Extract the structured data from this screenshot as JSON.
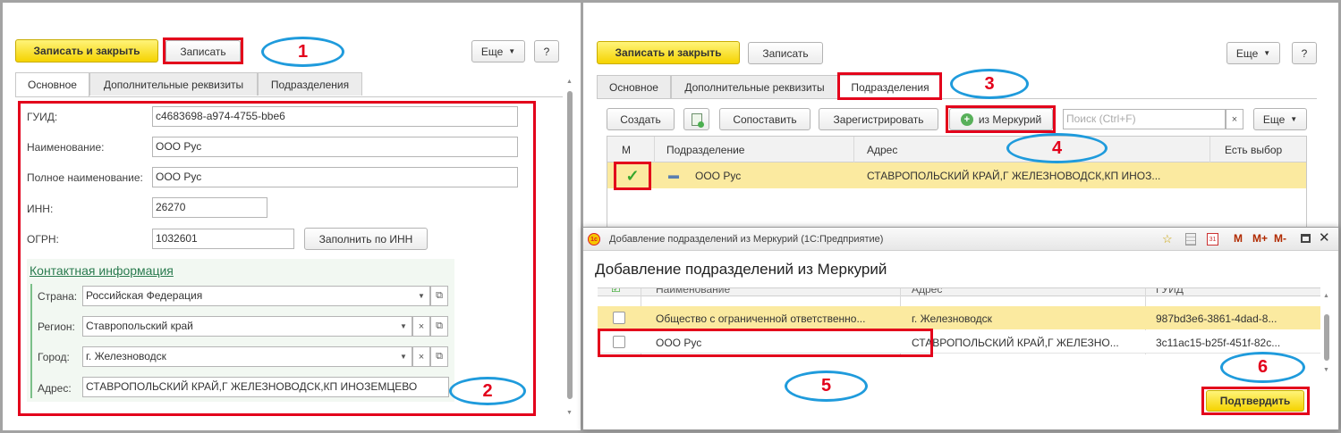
{
  "left": {
    "btn_save_close": "Записать и закрыть",
    "btn_save": "Записать",
    "btn_more": "Еще",
    "btn_help": "?",
    "tabs": [
      "Основное",
      "Дополнительные реквизиты",
      "Подразделения"
    ],
    "fields": {
      "guid_label": "ГУИД:",
      "guid_value": "c4683698-a974-4755-bbe6",
      "name_label": "Наименование:",
      "name_value": "ООО Рус",
      "fullname_label": "Полное наименование:",
      "fullname_value": "ООО Рус",
      "inn_label": "ИНН:",
      "inn_value": "26270",
      "ogrn_label": "ОГРН:",
      "ogrn_value": "1032601",
      "fill_by_inn": "Заполнить по ИНН"
    },
    "contact": {
      "title": "Контактная информация",
      "country_label": "Страна:",
      "country_value": "Российская Федерация",
      "region_label": "Регион:",
      "region_value": "Ставропольский край",
      "city_label": "Город:",
      "city_value": "г. Железноводск",
      "address_label": "Адрес:",
      "address_value": "СТАВРОПОЛЬСКИЙ КРАЙ,Г ЖЕЛЕЗНОВОДСК,КП ИНОЗЕМЦЕВО"
    }
  },
  "right": {
    "btn_save_close": "Записать и закрыть",
    "btn_save": "Записать",
    "btn_more": "Еще",
    "btn_help": "?",
    "tabs": [
      "Основное",
      "Дополнительные реквизиты",
      "Подразделения"
    ],
    "toolbar": {
      "create": "Создать",
      "match": "Сопоставить",
      "register": "Зарегистрировать",
      "from_mercury": "из Меркурий",
      "search_placeholder": "Поиск (Ctrl+F)",
      "clear": "×",
      "more": "Еще"
    },
    "table": {
      "headers": [
        "М",
        "Подразделение",
        "Адрес",
        "Есть выбор"
      ],
      "row": {
        "name": "ООО Рус",
        "address": "СТАВРОПОЛЬСКИЙ КРАЙ,Г ЖЕЛЕЗНОВОДСК,КП ИНОЗ..."
      }
    }
  },
  "dialog": {
    "window_title": "Добавление подразделений из Меркурий  (1С:Предприятие)",
    "title_controls": [
      "M",
      "M+",
      "M-"
    ],
    "heading": "Добавление подразделений из Меркурий",
    "headers": [
      "Наименование",
      "Адрес",
      "ГУИД"
    ],
    "rows": [
      {
        "name": "Общество с ограниченной ответственно...",
        "address": "г. Железноводск",
        "guid": "987bd3e6-3861-4dad-8..."
      },
      {
        "name": "ООО Рус",
        "address": "СТАВРОПОЛЬСКИЙ КРАЙ,Г ЖЕЛЕЗНО...",
        "guid": "3c11ac15-b25f-451f-82c..."
      }
    ],
    "confirm": "Подтвердить"
  },
  "markers": [
    "1",
    "2",
    "3",
    "4",
    "5",
    "6"
  ],
  "colors": {
    "accent_yellow": "#f5d300",
    "highlight_red": "#e3001b",
    "marker_blue": "#1f9bdc",
    "row_selected": "#fbeaa0"
  }
}
